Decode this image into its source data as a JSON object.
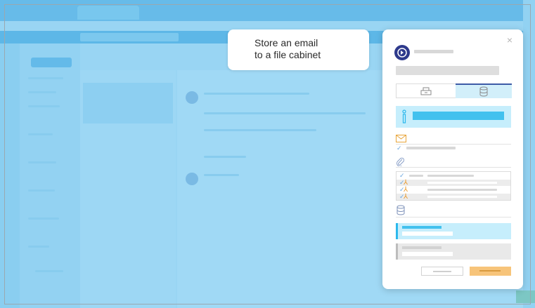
{
  "callout": {
    "text": "Store an email\nto a file cabinet"
  },
  "dialog": {
    "close_label": "×",
    "icons": {
      "logo": "app-logo-icon",
      "cabinet_tab": "file-cabinet-icon",
      "database_tab": "database-icon",
      "info": "info-icon",
      "email": "envelope-icon",
      "attachment": "paperclip-icon",
      "destination": "database-icon",
      "pdf": "pdf-icon"
    },
    "attachments": {
      "checked_rows": 4,
      "pdf_rows": 3
    },
    "destination_options": [
      {
        "selected": true
      },
      {
        "selected": false
      }
    ]
  },
  "colors": {
    "overlay": "#8fd0ef",
    "accent_blue": "#2bb8ec",
    "info_bg": "#c6eefc",
    "logo": "#2e3a8c",
    "pdf_orange": "#e99a2c",
    "primary_button": "#f7c47a",
    "tab_indicator": "#3d5aa6"
  }
}
